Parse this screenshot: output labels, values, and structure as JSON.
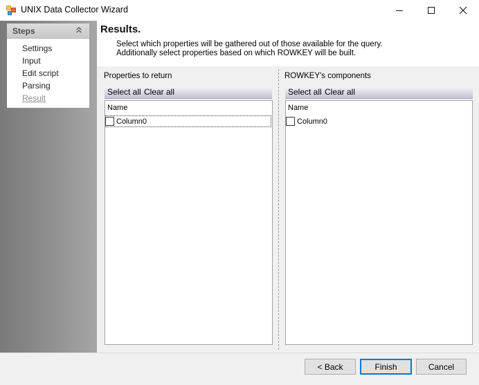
{
  "window": {
    "title": "UNIX Data Collector Wizard",
    "controls": [
      "minimize",
      "maximize",
      "close"
    ]
  },
  "sidebar": {
    "header": "Steps",
    "items": [
      {
        "label": "Settings",
        "state": "done"
      },
      {
        "label": "Input",
        "state": "done"
      },
      {
        "label": "Edit script",
        "state": "done"
      },
      {
        "label": "Parsing",
        "state": "done"
      },
      {
        "label": "Result",
        "state": "current"
      }
    ]
  },
  "main": {
    "title": "Results.",
    "description": [
      "Select which properties will be gathered out of those available for the query.",
      "Additionally select properties based on which ROWKEY will be built."
    ],
    "left_panel": {
      "label": "Properties to return",
      "select_all": "Select all",
      "clear_all": "Clear all",
      "column_header": "Name",
      "rows": [
        {
          "label": "Column0",
          "checked": false
        }
      ]
    },
    "right_panel": {
      "label": "ROWKEY's components",
      "select_all": "Select all",
      "clear_all": "Clear all",
      "column_header": "Name",
      "rows": [
        {
          "label": "Column0",
          "checked": false
        }
      ]
    }
  },
  "footer": {
    "back": "< Back",
    "finish": "Finish",
    "cancel": "Cancel"
  }
}
